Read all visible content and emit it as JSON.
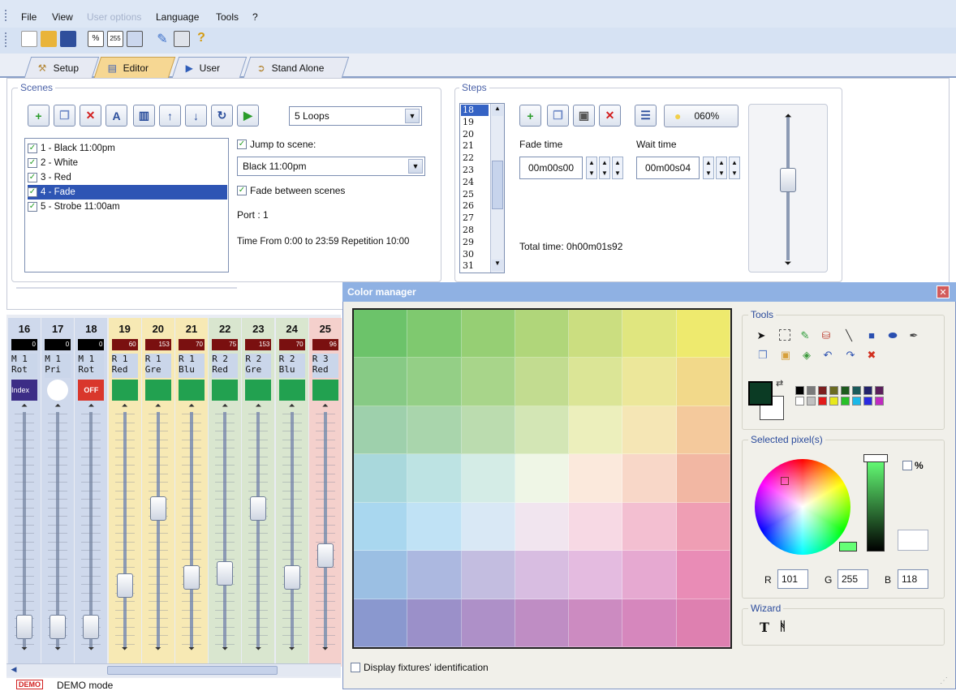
{
  "menu": [
    "File",
    "View",
    "User options",
    "Language",
    "Tools",
    "?"
  ],
  "tabs": [
    {
      "label": "Setup",
      "active": false
    },
    {
      "label": "Editor",
      "active": true
    },
    {
      "label": "User",
      "active": false
    },
    {
      "label": "Stand Alone",
      "active": false
    }
  ],
  "toolbar_icons": [
    "new-icon",
    "open-icon",
    "save-icon",
    "fixture-icon",
    "dmx-255-icon",
    "window-icon",
    "pin-icon",
    "hardware-icon",
    "help-icon"
  ],
  "scenes": {
    "title": "Scenes",
    "loops": "5 Loops",
    "items": [
      {
        "label": "1 - Black 11:00pm",
        "checked": true,
        "selected": false
      },
      {
        "label": "2 - White",
        "checked": true,
        "selected": false
      },
      {
        "label": "3 - Red",
        "checked": true,
        "selected": false
      },
      {
        "label": "4 - Fade",
        "checked": true,
        "selected": true
      },
      {
        "label": "5 - Strobe 11:00am",
        "checked": true,
        "selected": false
      }
    ],
    "jump_label": "Jump to scene:",
    "jump_target": "Black 11:00pm",
    "fade_label": "Fade between scenes",
    "port": "Port : 1",
    "time_info": "Time From 0:00  to  23:59 Repetition 10:00"
  },
  "steps": {
    "title": "Steps",
    "numbers": [
      "18",
      "19",
      "20",
      "21",
      "22",
      "23",
      "24",
      "25",
      "26",
      "27",
      "28",
      "29",
      "30",
      "31"
    ],
    "selected": "18",
    "dimmer": "060%",
    "fade_label": "Fade time",
    "fade_value": "00m00s00",
    "wait_label": "Wait time",
    "wait_value": "00m00s04",
    "total": "Total time: 0h00m01s92"
  },
  "channels": [
    {
      "num": "16",
      "value": "0",
      "name1": "M 1",
      "name2": "Rot",
      "level": 0,
      "color": "#cfd9ec",
      "icon": "index",
      "icon_label": "Index"
    },
    {
      "num": "17",
      "value": "0",
      "name1": "M 1",
      "name2": "Pri",
      "level": 0,
      "color": "#cfd9ec",
      "icon": "circle",
      "icon_label": ""
    },
    {
      "num": "18",
      "value": "0",
      "name1": "M 1",
      "name2": "Rot",
      "level": 0,
      "color": "#cfd9ec",
      "icon": "off",
      "icon_label": "OFF"
    },
    {
      "num": "19",
      "value": "60",
      "name1": "R 1",
      "name2": "Red",
      "level": 60,
      "color": "#f7e9b4",
      "icon": "green",
      "icon_label": ""
    },
    {
      "num": "20",
      "value": "153",
      "name1": "R 1",
      "name2": "Gre",
      "level": 153,
      "color": "#f7e9b4",
      "icon": "green",
      "icon_label": ""
    },
    {
      "num": "21",
      "value": "70",
      "name1": "R 1",
      "name2": "Blu",
      "level": 70,
      "color": "#f7e9b4",
      "icon": "green",
      "icon_label": ""
    },
    {
      "num": "22",
      "value": "75",
      "name1": "R 2",
      "name2": "Red",
      "level": 75,
      "color": "#d9e6cf",
      "icon": "green",
      "icon_label": ""
    },
    {
      "num": "23",
      "value": "153",
      "name1": "R 2",
      "name2": "Gre",
      "level": 153,
      "color": "#d9e6cf",
      "icon": "green",
      "icon_label": ""
    },
    {
      "num": "24",
      "value": "70",
      "name1": "R 2",
      "name2": "Blu",
      "level": 70,
      "color": "#d9e6cf",
      "icon": "green",
      "icon_label": ""
    },
    {
      "num": "25",
      "value": "96",
      "name1": "R 3",
      "name2": "Red",
      "level": 96,
      "color": "#f4d0cc",
      "icon": "green",
      "icon_label": ""
    }
  ],
  "color_manager": {
    "title": "Color manager",
    "palette": [
      [
        "#6cc36a",
        "#7fc96f",
        "#96cf74",
        "#b0d67a",
        "#cbde80",
        "#e0e67f",
        "#eeea6e"
      ],
      [
        "#87ca85",
        "#94cf86",
        "#a8d58a",
        "#c2dc90",
        "#dbe596",
        "#ece79a",
        "#f2d98a"
      ],
      [
        "#9ed0ac",
        "#a9d5ac",
        "#bbdcaf",
        "#d3e6b5",
        "#ecefbc",
        "#f5e6b5",
        "#f4c99c"
      ],
      [
        "#a9d8dc",
        "#bde3e3",
        "#d4ece6",
        "#eff6e6",
        "#fbe9dc",
        "#f8d7c8",
        "#f2b7a3"
      ],
      [
        "#a9d7ef",
        "#c0e2f5",
        "#d9e8f5",
        "#f1e5ef",
        "#f7d9e4",
        "#f3bfd1",
        "#ef9eb4"
      ],
      [
        "#9bbfe3",
        "#acb8e0",
        "#c3bde0",
        "#d8bde1",
        "#e4bbe0",
        "#e6a9d1",
        "#e98cb6"
      ],
      [
        "#8a98cf",
        "#9b90c9",
        "#ae90c8",
        "#bf8dc4",
        "#cc8bc1",
        "#d687bd",
        "#de80b0"
      ]
    ],
    "tools_label": "Tools",
    "tools_row1": [
      "pointer-icon",
      "select-rect-icon",
      "pencil-icon",
      "fill-icon",
      "line-icon",
      "rectangle-icon",
      "ellipse-icon",
      "eyedropper-icon"
    ],
    "tools_row2": [
      "copy-icon",
      "paste-icon",
      "fixture-color-icon",
      "undo-icon",
      "redo-icon",
      "clear-icon"
    ],
    "fg_color": "#0b3b24",
    "bg_color": "#ffffff",
    "swatches": [
      "#000000",
      "#7a7a7a",
      "#7b1f1f",
      "#6b6b22",
      "#1e5a1e",
      "#1b5a5a",
      "#23236b",
      "#5b1e5b",
      "#ffffff",
      "#c0c0c0",
      "#e21b1b",
      "#e8e81b",
      "#28c028",
      "#1bb8e8",
      "#2a2ae0",
      "#c02ac0"
    ],
    "selected_label": "Selected pixel(s)",
    "percent_label": "%",
    "r_label": "R",
    "r": "101",
    "g_label": "G",
    "g": "255",
    "b_label": "B",
    "b": "118",
    "wizard_label": "Wizard",
    "display_label": "Display fixtures' identification"
  },
  "status": {
    "badge": "DEMO",
    "text": "DEMO mode"
  }
}
